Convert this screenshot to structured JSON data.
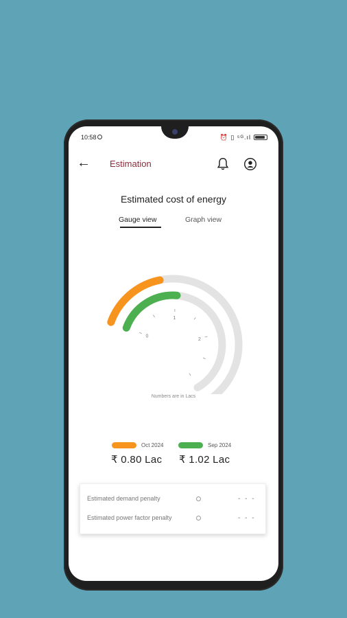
{
  "status_bar": {
    "time": "10:58",
    "indicators": "⏰ ▯ ⁵ᴳ.ıl"
  },
  "app_bar": {
    "title": "Estimation",
    "back_icon": "arrow-left-icon",
    "bell_icon": "bell-icon",
    "profile_icon": "user-circle-icon"
  },
  "page": {
    "heading": "Estimated cost of energy",
    "tabs": [
      {
        "label": "Gauge view",
        "active": true
      },
      {
        "label": "Graph view",
        "active": false
      }
    ],
    "note": "Numbers are in Lacs"
  },
  "gauge": {
    "scale_labels": [
      "0",
      "1",
      "2"
    ],
    "scale_max": 3,
    "outer": {
      "value": 0.8,
      "color": "#f7941d"
    },
    "inner": {
      "value": 1.02,
      "color": "#4caf50"
    },
    "track_color": "#e3e3e3"
  },
  "legend": [
    {
      "label": "Oct 2024",
      "amount": "₹ 0.80 Lac",
      "color": "#f7941d"
    },
    {
      "label": "Sep 2024",
      "amount": "₹ 1.02 Lac",
      "color": "#4caf50"
    }
  ],
  "penalties": [
    {
      "label": "Estimated demand penalty",
      "value": "- - -"
    },
    {
      "label": "Estimated power factor penalty",
      "value": "- - -"
    }
  ]
}
